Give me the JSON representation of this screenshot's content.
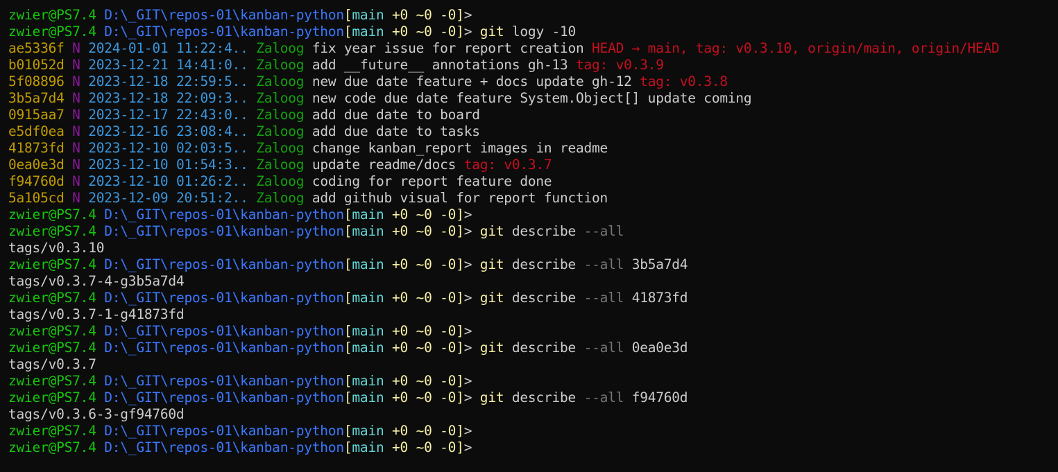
{
  "prompt": {
    "user_host": "zwier@PS7.4",
    "path": "D:\\_GIT\\repos-01\\kanban-python",
    "bracket_open": "[",
    "branch": "main",
    "status": "+0 ~0 -0",
    "bracket_close": "]",
    "symbol": ">"
  },
  "colors": {
    "prompt_user": "#16c60c",
    "prompt_path": "#3b78ff",
    "prompt_bracket": "#f9f1a5",
    "prompt_branch": "#61d6d6",
    "command": "#f9f1a5",
    "flag": "#767676",
    "hash": "#c19c00",
    "marker": "#881798",
    "date": "#3a96dd",
    "author": "#13a10e",
    "refs": "#c50f1f",
    "background": "#0c0c0c",
    "foreground": "#cccccc"
  },
  "lines": [
    {
      "kind": "prompt",
      "cmd": "",
      "args": ""
    },
    {
      "kind": "prompt",
      "cmd": "git",
      "args": " logy -10"
    },
    {
      "kind": "log",
      "hash": "ae5336f",
      "marker": "N",
      "date": "2024-01-01 11:22:4..",
      "author": "Zaloog",
      "message": "fix year issue for report creation",
      "refs": "HEAD → main, tag: v0.3.10, origin/main, origin/HEAD"
    },
    {
      "kind": "log",
      "hash": "b01052d",
      "marker": "N",
      "date": "2023-12-21 14:41:0..",
      "author": "Zaloog",
      "message": "add __future__ annotations gh-13",
      "refs": "tag: v0.3.9"
    },
    {
      "kind": "log",
      "hash": "5f08896",
      "marker": "N",
      "date": "2023-12-18 22:59:5..",
      "author": "Zaloog",
      "message": "new due date feature + docs update gh-12",
      "refs": "tag: v0.3.8"
    },
    {
      "kind": "log",
      "hash": "3b5a7d4",
      "marker": "N",
      "date": "2023-12-18 22:09:3..",
      "author": "Zaloog",
      "message": "new code due date feature System.Object[] update coming",
      "refs": ""
    },
    {
      "kind": "log",
      "hash": "0915aa7",
      "marker": "N",
      "date": "2023-12-17 22:43:0..",
      "author": "Zaloog",
      "message": "add due date to board",
      "refs": ""
    },
    {
      "kind": "log",
      "hash": "e5df0ea",
      "marker": "N",
      "date": "2023-12-16 23:08:4..",
      "author": "Zaloog",
      "message": "add due date to tasks",
      "refs": ""
    },
    {
      "kind": "log",
      "hash": "41873fd",
      "marker": "N",
      "date": "2023-12-10 02:03:5..",
      "author": "Zaloog",
      "message": "change kanban_report images in readme",
      "refs": ""
    },
    {
      "kind": "log",
      "hash": "0ea0e3d",
      "marker": "N",
      "date": "2023-12-10 01:54:3..",
      "author": "Zaloog",
      "message": "update readme/docs",
      "refs": "tag: v0.3.7"
    },
    {
      "kind": "log",
      "hash": "f94760d",
      "marker": "N",
      "date": "2023-12-10 01:26:2..",
      "author": "Zaloog",
      "message": "coding for report feature done",
      "refs": ""
    },
    {
      "kind": "log",
      "hash": "5a105cd",
      "marker": "N",
      "date": "2023-12-09 20:51:2..",
      "author": "Zaloog",
      "message": "add github visual for report function",
      "refs": ""
    },
    {
      "kind": "prompt",
      "cmd": "",
      "args": ""
    },
    {
      "kind": "prompt",
      "cmd": "git",
      "args": " describe",
      "flag": " --all",
      "tail": ""
    },
    {
      "kind": "output",
      "text": "tags/v0.3.10"
    },
    {
      "kind": "prompt",
      "cmd": "git",
      "args": " describe",
      "flag": " --all",
      "tail": " 3b5a7d4"
    },
    {
      "kind": "output",
      "text": "tags/v0.3.7-4-g3b5a7d4"
    },
    {
      "kind": "prompt",
      "cmd": "git",
      "args": " describe",
      "flag": " --all",
      "tail": " 41873fd"
    },
    {
      "kind": "output",
      "text": "tags/v0.3.7-1-g41873fd"
    },
    {
      "kind": "prompt",
      "cmd": "",
      "args": ""
    },
    {
      "kind": "prompt",
      "cmd": "git",
      "args": " describe",
      "flag": " --all",
      "tail": " 0ea0e3d"
    },
    {
      "kind": "output",
      "text": "tags/v0.3.7"
    },
    {
      "kind": "prompt",
      "cmd": "",
      "args": ""
    },
    {
      "kind": "prompt",
      "cmd": "git",
      "args": " describe",
      "flag": " --all",
      "tail": " f94760d"
    },
    {
      "kind": "output",
      "text": "tags/v0.3.6-3-gf94760d"
    },
    {
      "kind": "prompt",
      "cmd": "",
      "args": ""
    },
    {
      "kind": "prompt",
      "cmd": "",
      "args": ""
    }
  ]
}
